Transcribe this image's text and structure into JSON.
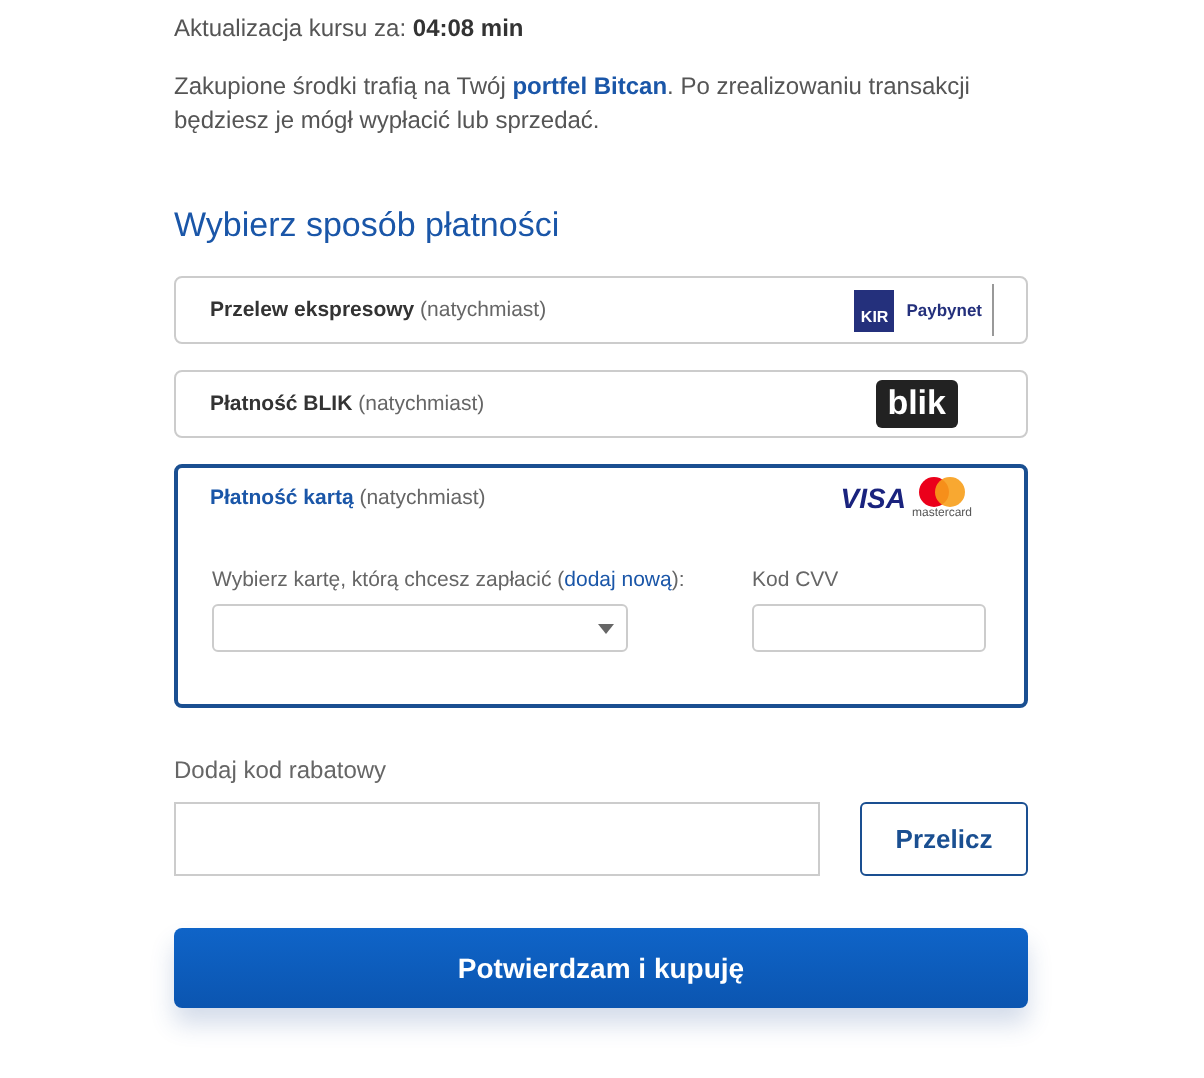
{
  "rate_update": "Aktualizacja kursu za: **04:08 min**",
  "info": {
    "before": "Zakupione środki trafią na Twój ",
    "link": "portfel Bitcan",
    "after": ". Po zrealizowaniu transakcji będziesz je mógł wypłacić lub sprzedać."
  },
  "section_title": "Wybierz sposób płatności",
  "methods": [
    {
      "kind": "transfer",
      "label": "**Przelew ekspresowy** (natychmiast)",
      "selected": false,
      "logo": [
        "KIR",
        "Paybynet"
      ]
    },
    {
      "kind": "blik",
      "label": "**Płatność BLIK** (natychmiast)",
      "selected": false,
      "logo": [
        "blik"
      ]
    },
    {
      "kind": "card",
      "label": "**Płatność kartą** (natychmiast)",
      "selected": true,
      "logo": [
        "VISA",
        "mastercard"
      ],
      "card_select": {
        "before": "Wybierz kartę, którą chcesz zapłacić (",
        "link": "dodaj nową",
        "after": "):"
      },
      "cvv_label": "Kod CVV"
    }
  ],
  "discount": {
    "label": "Dodaj kod rabatowy",
    "button": "Przelicz"
  },
  "confirm_button": "Potwierdzam i kupuję"
}
